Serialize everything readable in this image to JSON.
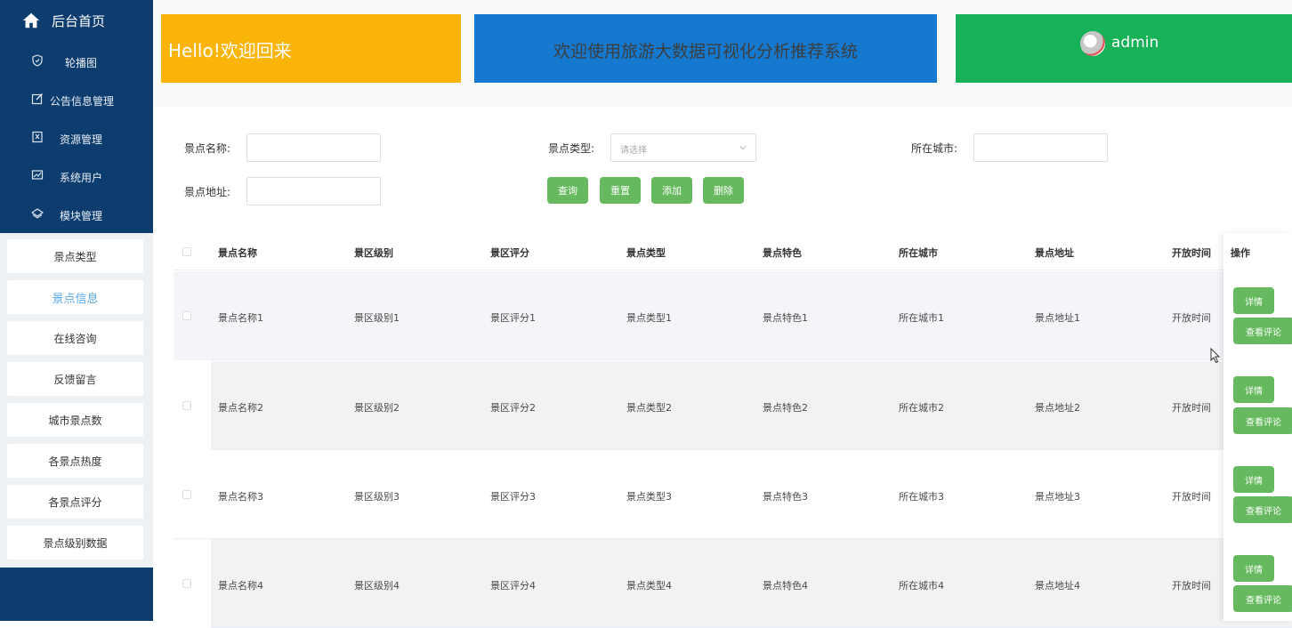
{
  "sidebar": {
    "home_label": "后台首页",
    "menu": [
      {
        "label": "轮播图",
        "icon": "shield-icon"
      },
      {
        "label": "公告信息管理",
        "icon": "edit-icon"
      },
      {
        "label": "资源管理",
        "icon": "resource-icon"
      },
      {
        "label": "系统用户",
        "icon": "chart-icon"
      },
      {
        "label": "模块管理",
        "icon": "layers-icon"
      }
    ],
    "submenu": [
      {
        "label": "景点类型"
      },
      {
        "label": "景点信息",
        "active": true
      },
      {
        "label": "在线咨询"
      },
      {
        "label": "反馈留言"
      },
      {
        "label": "城市景点数"
      },
      {
        "label": "各景点热度"
      },
      {
        "label": "各景点评分"
      },
      {
        "label": "景点级别数据"
      }
    ]
  },
  "header": {
    "welcome": "Hello!欢迎回来",
    "system_title": "欢迎使用旅游大数据可视化分析推荐系统",
    "username": "admin"
  },
  "search": {
    "name_label": "景点名称:",
    "type_label": "景点类型:",
    "type_placeholder": "请选择",
    "city_label": "所在城市:",
    "address_label": "景点地址:",
    "buttons": {
      "query": "查询",
      "reset": "重置",
      "add": "添加",
      "delete": "删除"
    }
  },
  "table": {
    "headers": [
      "景点名称",
      "景区级别",
      "景区评分",
      "景点类型",
      "景点特色",
      "所在城市",
      "景点地址",
      "开放时间",
      "操作"
    ],
    "rows": [
      [
        "景点名称1",
        "景区级别1",
        "景区评分1",
        "景点类型1",
        "景点特色1",
        "所在城市1",
        "景点地址1",
        "开放时间"
      ],
      [
        "景点名称2",
        "景区级别2",
        "景区评分2",
        "景点类型2",
        "景点特色2",
        "所在城市2",
        "景点地址2",
        "开放时间"
      ],
      [
        "景点名称3",
        "景区级别3",
        "景区评分3",
        "景点类型3",
        "景点特色3",
        "所在城市3",
        "景点地址3",
        "开放时间"
      ],
      [
        "景点名称4",
        "景区级别4",
        "景区评分4",
        "景点类型4",
        "景点特色4",
        "所在城市4",
        "景点地址4",
        "开放时间"
      ]
    ],
    "actions": {
      "detail": "详情",
      "comments": "查看评论"
    }
  },
  "colors": {
    "sidebar_bg": "#0d3c6e",
    "yellow_card": "#fbb50a",
    "blue_card": "#1479cf",
    "green_card": "#17b157",
    "button_green": "#67b960",
    "active_submenu_text": "#5aa9e6"
  }
}
